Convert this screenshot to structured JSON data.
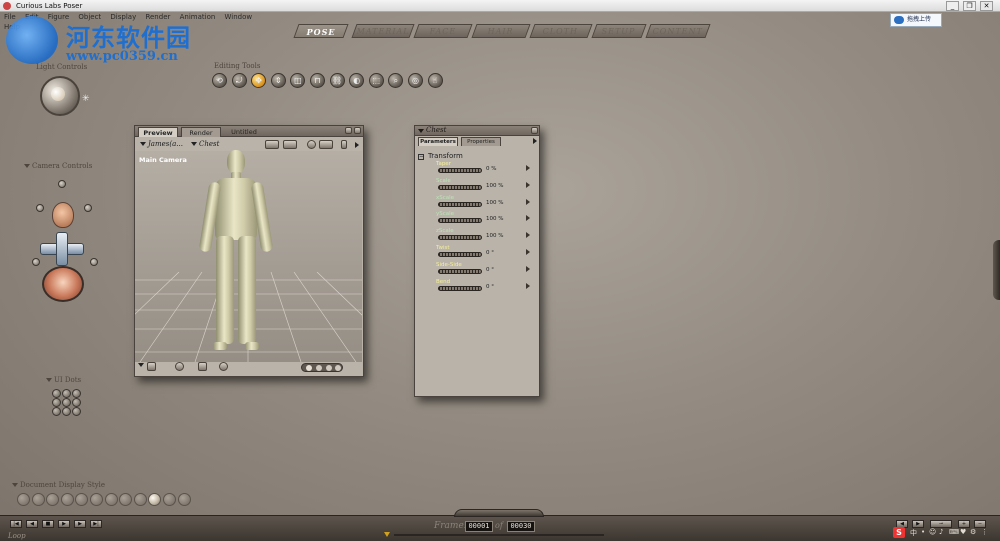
{
  "window": {
    "title": "Curious Labs Poser",
    "controls": [
      "_",
      "❐",
      "✕"
    ]
  },
  "menu": [
    "File",
    "Edit",
    "Figure",
    "Object",
    "Display",
    "Render",
    "Animation",
    "Window",
    "Help"
  ],
  "watermark": {
    "title": "河东软件园",
    "url": "www.pc0359.cn"
  },
  "upload_button": {
    "label": "拖拽上传"
  },
  "room_tabs": [
    {
      "label": "POSE",
      "active": true
    },
    {
      "label": "MATERIAL",
      "active": false
    },
    {
      "label": "FACE",
      "active": false
    },
    {
      "label": "HAIR",
      "active": false
    },
    {
      "label": "CLOTH",
      "active": false
    },
    {
      "label": "SETUP",
      "active": false
    },
    {
      "label": "CONTENT",
      "active": false
    }
  ],
  "left": {
    "light_controls": "Light Controls",
    "camera_controls": "Camera Controls",
    "ui_dots": "UI Dots",
    "document_display_style": "Document Display Style"
  },
  "editing_tools": {
    "label": "Editing Tools",
    "tools": [
      "rotate-icon",
      "twist-icon",
      "translate-icon",
      "translate-in-out-icon",
      "scale-icon",
      "taper-icon",
      "chain-break-icon",
      "color-icon",
      "grouping-icon",
      "view-magnifier-icon",
      "morph-brush-icon",
      "direct-manipulation-icon"
    ],
    "active_index": 2
  },
  "document": {
    "tabs": [
      {
        "label": "Preview",
        "active": true
      },
      {
        "label": "Render",
        "active": false
      },
      {
        "label": "Untitled",
        "active": false
      }
    ],
    "figure_select": "James(a...",
    "actor_select": "Chest",
    "camera_label": "Main Camera"
  },
  "parameters": {
    "actor": "Chest",
    "tabs": [
      {
        "label": "Parameters",
        "active": true
      },
      {
        "label": "Properties",
        "active": false
      }
    ],
    "group": "Transform",
    "rows": [
      {
        "name": "Taper",
        "value": "0 %",
        "green": false
      },
      {
        "name": "Scale",
        "value": "100 %",
        "green": true
      },
      {
        "name": "xScale",
        "value": "100 %",
        "green": true
      },
      {
        "name": "yScale",
        "value": "100 %",
        "green": true
      },
      {
        "name": "zScale",
        "value": "100 %",
        "green": true
      },
      {
        "name": "Twist",
        "value": "0 °",
        "green": false
      },
      {
        "name": "Side-Side",
        "value": "0 °",
        "green": false
      },
      {
        "name": "Bend",
        "value": "0 °",
        "green": false
      }
    ]
  },
  "timeline": {
    "frame_label": "Frame:",
    "current_frame": "00001",
    "of_label": "of",
    "total_frames": "00030",
    "loop_label": "Loop"
  }
}
